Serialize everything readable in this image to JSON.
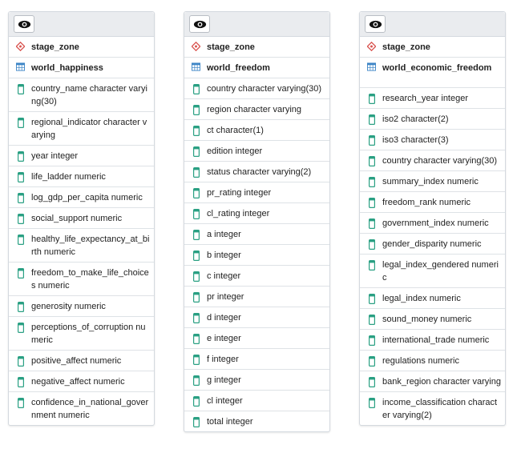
{
  "tables": [
    {
      "schema": "stage_zone",
      "name": "world_happiness",
      "columns": [
        "country_name character varying(30)",
        "regional_indicator character varying",
        "year integer",
        "life_ladder numeric",
        "log_gdp_per_capita numeric",
        "social_support numeric",
        "healthy_life_expectancy_at_birth numeric",
        "freedom_to_make_life_choices numeric",
        "generosity numeric",
        "perceptions_of_corruption numeric",
        "positive_affect numeric",
        "negative_affect numeric",
        "confidence_in_national_government numeric"
      ]
    },
    {
      "schema": "stage_zone",
      "name": "world_freedom",
      "columns": [
        "country character varying(30)",
        "region character varying",
        "ct character(1)",
        "edition integer",
        "status character varying(2)",
        "pr_rating integer",
        "cl_rating integer",
        "a integer",
        "b integer",
        "c integer",
        "pr integer",
        "d integer",
        "e integer",
        "f integer",
        "g integer",
        "cl integer",
        "total integer"
      ]
    },
    {
      "schema": "stage_zone",
      "name": "world_economic_freedom",
      "columns": [
        "research_year integer",
        "iso2 character(2)",
        "iso3 character(3)",
        "country character varying(30)",
        "summary_index numeric",
        "freedom_rank numeric",
        "government_index numeric",
        "gender_disparity numeric",
        "legal_index_gendered numeric",
        "legal_index numeric",
        "sound_money numeric",
        "international_trade numeric",
        "regulations numeric",
        "bank_region character varying",
        "income_classification character varying(2)"
      ]
    }
  ],
  "colors": {
    "schema_icon": "#d9534f",
    "table_icon": "#3d85c6",
    "column_icon": "#2aa083",
    "header_bg": "#eaecef"
  },
  "icons": {
    "header_button": "eye-icon",
    "schema": "schema-diamond-icon",
    "table": "table-grid-icon",
    "column": "column-icon"
  }
}
